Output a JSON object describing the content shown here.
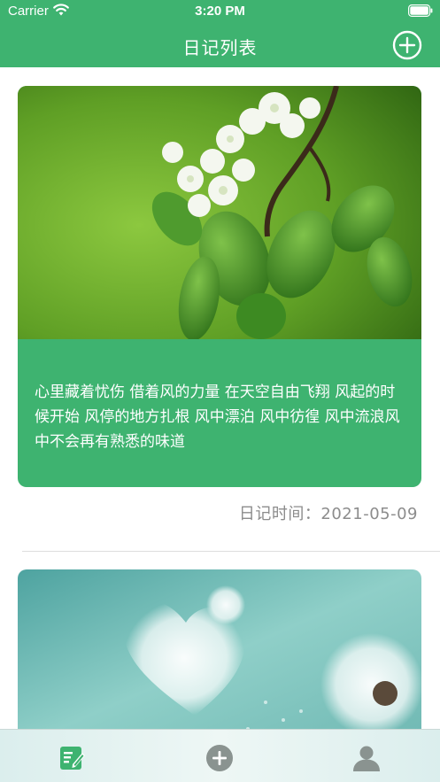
{
  "status_bar": {
    "carrier": "Carrier",
    "time": "3:20 PM"
  },
  "nav": {
    "title": "日记列表",
    "add_icon": "plus-circle-icon"
  },
  "diary_entries": [
    {
      "image": "pear-blossom-photo",
      "text": "心里藏着忧伤 借着风的力量 在天空自由飞翔 风起的时候开始 风停的地方扎根 风中漂泊 风中彷徨 风中流浪风中不会再有熟悉的味道",
      "time": "日记时间：2021-05-09"
    },
    {
      "image": "dandelion-photo"
    }
  ],
  "tab_bar": {
    "items": [
      {
        "icon": "diary-edit-icon",
        "active": true
      },
      {
        "icon": "add-circle-icon",
        "active": false
      },
      {
        "icon": "profile-icon",
        "active": false
      }
    ]
  },
  "colors": {
    "accent": "#3eb370",
    "tab_inactive": "#8a9390",
    "secondary_text": "#8c8c8c"
  }
}
